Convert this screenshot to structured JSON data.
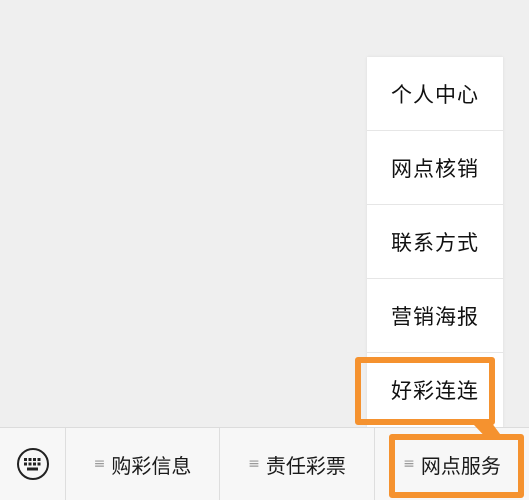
{
  "submenu": {
    "items": [
      {
        "label": "个人中心"
      },
      {
        "label": "网点核销"
      },
      {
        "label": "联系方式"
      },
      {
        "label": "营销海报"
      },
      {
        "label": "好彩连连"
      }
    ]
  },
  "menu_bar": {
    "keyboard_icon": "keyboard-icon",
    "tabs": [
      {
        "label": "购彩信息",
        "icon": "menu-lines-icon"
      },
      {
        "label": "责任彩票",
        "icon": "menu-lines-icon"
      },
      {
        "label": "网点服务",
        "icon": "menu-lines-icon"
      }
    ]
  },
  "colors": {
    "highlight": "#f5922f",
    "background": "#efefef",
    "menu_bar": "#f7f7f7"
  }
}
